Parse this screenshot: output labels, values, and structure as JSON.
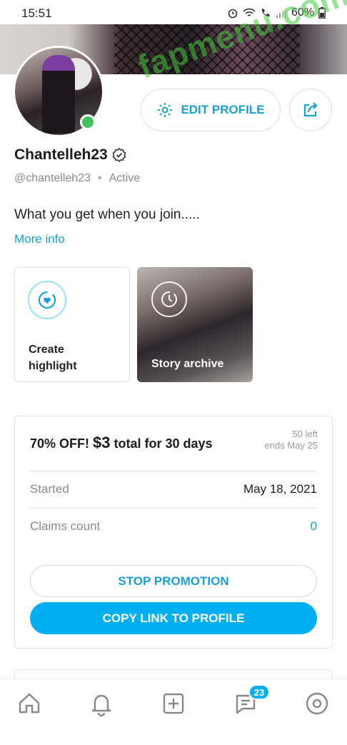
{
  "status_bar": {
    "time": "15:51",
    "battery": "60%"
  },
  "profile": {
    "display_name": "Chantelleh23",
    "handle": "@chantelleh23",
    "status": "Active",
    "bio": "What you get when you join.....",
    "more_info": "More info",
    "edit_profile": "EDIT PROFILE"
  },
  "highlights": {
    "create": "Create highlight",
    "archive": "Story archive"
  },
  "promotion": {
    "title_prefix": "70% OFF!",
    "price": "$3",
    "title_suffix": "total for 30 days",
    "left": "50 left",
    "ends": "ends May 25",
    "started_label": "Started",
    "started_value": "May 18, 2021",
    "claims_label": "Claims count",
    "claims_value": "0",
    "stop_button": "STOP PROMOTION",
    "copy_button": "COPY LINK TO PROFILE"
  },
  "tab_bar": {
    "messages_badge": "23"
  },
  "watermark": "fapmenu.com",
  "colors": {
    "accent": "#00aff0",
    "link": "#1a9fd4",
    "online": "#3fc15b"
  }
}
